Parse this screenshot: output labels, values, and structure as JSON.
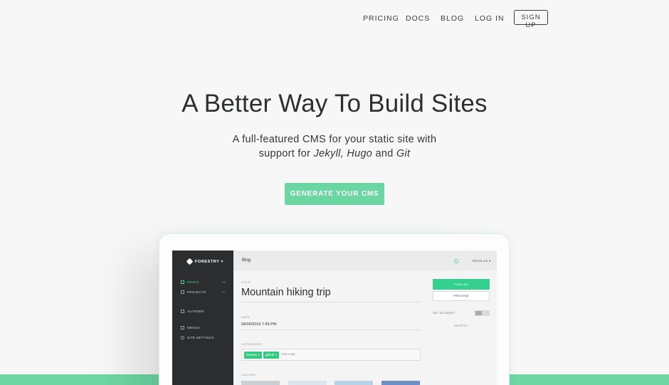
{
  "nav": {
    "items": [
      "PRICING",
      "DOCS",
      "BLOG",
      "LOG IN"
    ],
    "signup": "SIGN UP"
  },
  "hero": {
    "title": "A Better Way To Build Sites",
    "sub_line1": "A full-featured CMS for your static site with",
    "sub_prefix": "support for ",
    "sub_jekyll": "Jekyll,",
    "sub_hugo": "Hugo",
    "sub_and": " and ",
    "sub_git": "Git",
    "cta": "GENERATE YOUR CMS"
  },
  "colors": {
    "accent": "#6bd6a2",
    "sidebar": "#2c2d2f",
    "active": "#4fd19a"
  },
  "app": {
    "brand": "FORESTRY",
    "sidebar": [
      {
        "label": "POSTS",
        "count": "12",
        "icon": "posts-icon"
      },
      {
        "label": "PROJECTS",
        "count": "14",
        "icon": "grid-icon"
      },
      {
        "label": "AUTHORS",
        "count": "",
        "icon": "authors-icon"
      },
      {
        "label": "MENUS",
        "count": "",
        "icon": "menu-icon"
      },
      {
        "label": "SITE SETTINGS",
        "count": "",
        "icon": "gear-icon"
      }
    ],
    "section_title": "Blog",
    "user": "NICHLAS",
    "title_label": "TITLE",
    "post_title": "Mountain hiking trip",
    "date_label": "DATE",
    "date_value": "09/06/2016 7:45 PM",
    "categories_label": "CATEGORIES",
    "tags": [
      "forestry ×",
      "github ×"
    ],
    "add_tag_placeholder": "Add a tag",
    "gallery_label": "GALLERY",
    "publish": "PUBLISH",
    "preview": "PREVIEW",
    "draft": "SET AS DRAFT",
    "delete": "DELETE"
  }
}
